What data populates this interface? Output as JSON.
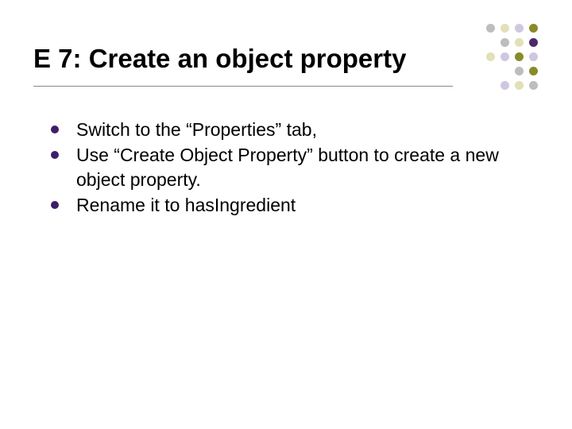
{
  "title": "E 7: Create an object property",
  "bullets": [
    "Switch to the “Properties” tab,",
    "Use “Create Object Property” button to create a new object property.",
    "Rename it to hasIngredient"
  ],
  "decor_colors": {
    "purple": "#4b2a6b",
    "olive": "#8a8a2a",
    "lav": "#cfc7df",
    "pale": "#e3e0b8",
    "grey": "#bdbdbd"
  }
}
